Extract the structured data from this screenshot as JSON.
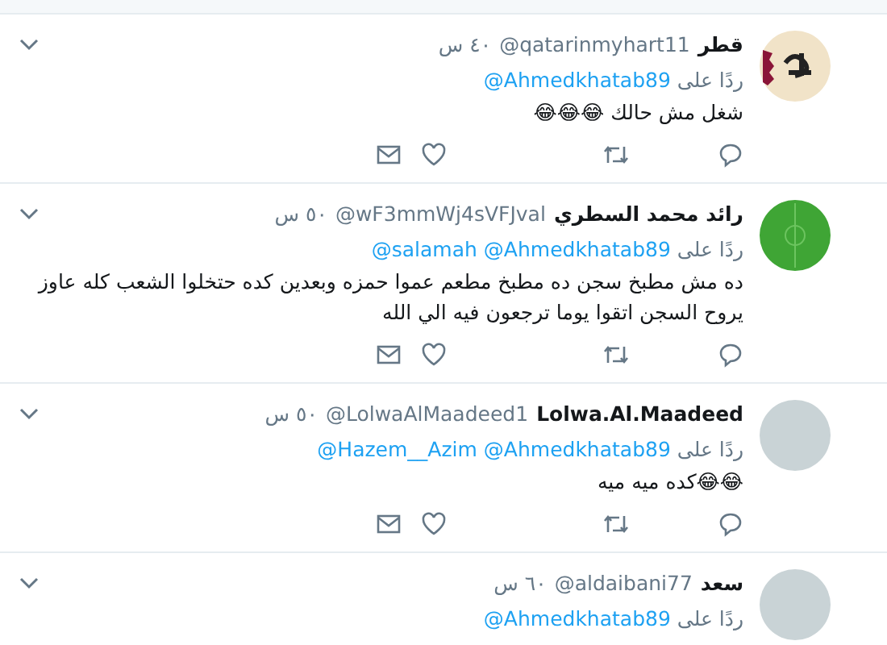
{
  "tweets": [
    {
      "name": "قطر",
      "handle": "@qatarinmyhart11",
      "time": "٤٠ س",
      "kind": "flag",
      "reply_label": "ردًا على",
      "mentions": [
        "@Ahmedkhatab89"
      ],
      "text": "شغل مش حالك 😂😂😂"
    },
    {
      "name": "رائد محمد السطري",
      "handle": "@wF3mmWj4sVFJval",
      "time": "٥٠ س",
      "kind": "field",
      "reply_label": "ردًا على",
      "mentions": [
        "@Ahmedkhatab89",
        "@salamah"
      ],
      "text": "ده مش مطبخ سجن ده مطبخ مطعم عموا حمزه وبعدين كده حتخلوا الشعب كله عاوز يروح السجن اتقوا يوما ترجعون فيه الي الله"
    },
    {
      "name": "Lolwa.Al.Maadeed",
      "handle": "@LolwaAlMaadeed1",
      "time": "٥٠ س",
      "kind": "photo",
      "reply_label": "ردًا على",
      "mentions": [
        "@Ahmedkhatab89",
        "@Hazem__Azim"
      ],
      "text": "😂😂كده ميه ميه"
    },
    {
      "name": "سعد",
      "handle": "@aldaibani77",
      "time": "٦٠ س",
      "kind": "photo",
      "reply_label": "ردًا على",
      "mentions": [
        "@Ahmedkhatab89"
      ]
    }
  ]
}
